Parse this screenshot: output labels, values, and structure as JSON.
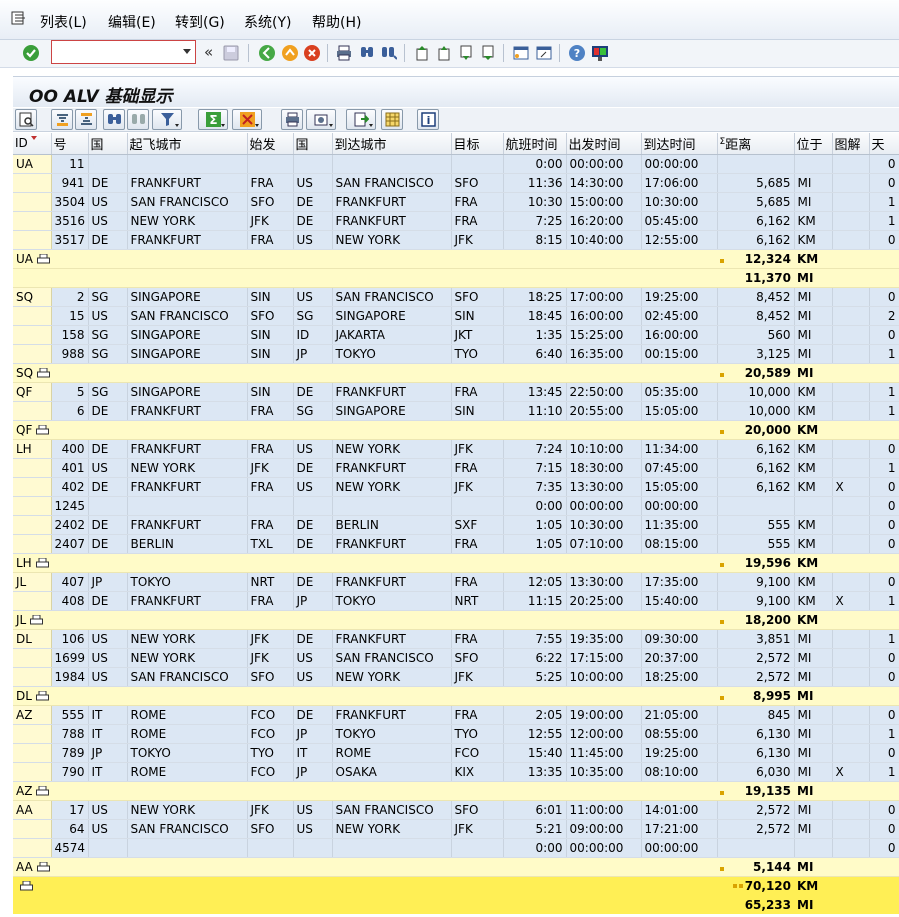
{
  "menu": [
    "列表(L)",
    "编辑(E)",
    "转到(G)",
    "系统(Y)",
    "帮助(H)"
  ],
  "toolbar": {
    "command_value": "",
    "command_placeholder": "",
    "back_symbol": "«"
  },
  "title": "OO ALV 基础显示",
  "columns": [
    "ID",
    "号",
    "国",
    "起飞城市",
    "始发",
    "国",
    "到达城市",
    "目标",
    "航班时间",
    "出发时间",
    "到达时间",
    "距离",
    "位于",
    "图解",
    "天"
  ],
  "rows": [
    {
      "id": "UA",
      "no": "11",
      "c1": "",
      "from": "",
      "fa": "",
      "c2": "",
      "to": "",
      "ta": "",
      "ft": "0:00",
      "dep": "00:00:00",
      "arr": "00:00:00",
      "dist": "",
      "unit": "",
      "ch": "",
      "day": "0"
    },
    {
      "id": "",
      "no": "941",
      "c1": "DE",
      "from": "FRANKFURT",
      "fa": "FRA",
      "c2": "US",
      "to": "SAN FRANCISCO",
      "ta": "SFO",
      "ft": "11:36",
      "dep": "14:30:00",
      "arr": "17:06:00",
      "dist": "5,685",
      "unit": "MI",
      "ch": "",
      "day": "0"
    },
    {
      "id": "",
      "no": "3504",
      "c1": "US",
      "from": "SAN FRANCISCO",
      "fa": "SFO",
      "c2": "DE",
      "to": "FRANKFURT",
      "ta": "FRA",
      "ft": "10:30",
      "dep": "15:00:00",
      "arr": "10:30:00",
      "dist": "5,685",
      "unit": "MI",
      "ch": "",
      "day": "1"
    },
    {
      "id": "",
      "no": "3516",
      "c1": "US",
      "from": "NEW YORK",
      "fa": "JFK",
      "c2": "DE",
      "to": "FRANKFURT",
      "ta": "FRA",
      "ft": "7:25",
      "dep": "16:20:00",
      "arr": "05:45:00",
      "dist": "6,162",
      "unit": "KM",
      "ch": "",
      "day": "1"
    },
    {
      "id": "",
      "no": "3517",
      "c1": "DE",
      "from": "FRANKFURT",
      "fa": "FRA",
      "c2": "US",
      "to": "NEW YORK",
      "ta": "JFK",
      "ft": "8:15",
      "dep": "10:40:00",
      "arr": "12:55:00",
      "dist": "6,162",
      "unit": "KM",
      "ch": "",
      "day": "0"
    },
    {
      "subtotal": true,
      "id": "UA",
      "lines": [
        [
          "12,324",
          "KM"
        ],
        [
          "11,370",
          "MI"
        ]
      ]
    },
    {
      "id": "SQ",
      "no": "2",
      "c1": "SG",
      "from": "SINGAPORE",
      "fa": "SIN",
      "c2": "US",
      "to": "SAN FRANCISCO",
      "ta": "SFO",
      "ft": "18:25",
      "dep": "17:00:00",
      "arr": "19:25:00",
      "dist": "8,452",
      "unit": "MI",
      "ch": "",
      "day": "0"
    },
    {
      "id": "",
      "no": "15",
      "c1": "US",
      "from": "SAN FRANCISCO",
      "fa": "SFO",
      "c2": "SG",
      "to": "SINGAPORE",
      "ta": "SIN",
      "ft": "18:45",
      "dep": "16:00:00",
      "arr": "02:45:00",
      "dist": "8,452",
      "unit": "MI",
      "ch": "",
      "day": "2"
    },
    {
      "id": "",
      "no": "158",
      "c1": "SG",
      "from": "SINGAPORE",
      "fa": "SIN",
      "c2": "ID",
      "to": "JAKARTA",
      "ta": "JKT",
      "ft": "1:35",
      "dep": "15:25:00",
      "arr": "16:00:00",
      "dist": "560",
      "unit": "MI",
      "ch": "",
      "day": "0"
    },
    {
      "id": "",
      "no": "988",
      "c1": "SG",
      "from": "SINGAPORE",
      "fa": "SIN",
      "c2": "JP",
      "to": "TOKYO",
      "ta": "TYO",
      "ft": "6:40",
      "dep": "16:35:00",
      "arr": "00:15:00",
      "dist": "3,125",
      "unit": "MI",
      "ch": "",
      "day": "1"
    },
    {
      "subtotal": true,
      "id": "SQ",
      "lines": [
        [
          "20,589",
          "MI"
        ]
      ]
    },
    {
      "id": "QF",
      "no": "5",
      "c1": "SG",
      "from": "SINGAPORE",
      "fa": "SIN",
      "c2": "DE",
      "to": "FRANKFURT",
      "ta": "FRA",
      "ft": "13:45",
      "dep": "22:50:00",
      "arr": "05:35:00",
      "dist": "10,000",
      "unit": "KM",
      "ch": "",
      "day": "1"
    },
    {
      "id": "",
      "no": "6",
      "c1": "DE",
      "from": "FRANKFURT",
      "fa": "FRA",
      "c2": "SG",
      "to": "SINGAPORE",
      "ta": "SIN",
      "ft": "11:10",
      "dep": "20:55:00",
      "arr": "15:05:00",
      "dist": "10,000",
      "unit": "KM",
      "ch": "",
      "day": "1"
    },
    {
      "subtotal": true,
      "id": "QF",
      "lines": [
        [
          "20,000",
          "KM"
        ]
      ]
    },
    {
      "id": "LH",
      "no": "400",
      "c1": "DE",
      "from": "FRANKFURT",
      "fa": "FRA",
      "c2": "US",
      "to": "NEW YORK",
      "ta": "JFK",
      "ft": "7:24",
      "dep": "10:10:00",
      "arr": "11:34:00",
      "dist": "6,162",
      "unit": "KM",
      "ch": "",
      "day": "0"
    },
    {
      "id": "",
      "no": "401",
      "c1": "US",
      "from": "NEW YORK",
      "fa": "JFK",
      "c2": "DE",
      "to": "FRANKFURT",
      "ta": "FRA",
      "ft": "7:15",
      "dep": "18:30:00",
      "arr": "07:45:00",
      "dist": "6,162",
      "unit": "KM",
      "ch": "",
      "day": "1"
    },
    {
      "id": "",
      "no": "402",
      "c1": "DE",
      "from": "FRANKFURT",
      "fa": "FRA",
      "c2": "US",
      "to": "NEW YORK",
      "ta": "JFK",
      "ft": "7:35",
      "dep": "13:30:00",
      "arr": "15:05:00",
      "dist": "6,162",
      "unit": "KM",
      "ch": "X",
      "day": "0"
    },
    {
      "id": "",
      "no": "1245",
      "c1": "",
      "from": "",
      "fa": "",
      "c2": "",
      "to": "",
      "ta": "",
      "ft": "0:00",
      "dep": "00:00:00",
      "arr": "00:00:00",
      "dist": "",
      "unit": "",
      "ch": "",
      "day": "0"
    },
    {
      "id": "",
      "no": "2402",
      "c1": "DE",
      "from": "FRANKFURT",
      "fa": "FRA",
      "c2": "DE",
      "to": "BERLIN",
      "ta": "SXF",
      "ft": "1:05",
      "dep": "10:30:00",
      "arr": "11:35:00",
      "dist": "555",
      "unit": "KM",
      "ch": "",
      "day": "0"
    },
    {
      "id": "",
      "no": "2407",
      "c1": "DE",
      "from": "BERLIN",
      "fa": "TXL",
      "c2": "DE",
      "to": "FRANKFURT",
      "ta": "FRA",
      "ft": "1:05",
      "dep": "07:10:00",
      "arr": "08:15:00",
      "dist": "555",
      "unit": "KM",
      "ch": "",
      "day": "0"
    },
    {
      "subtotal": true,
      "id": "LH",
      "lines": [
        [
          "19,596",
          "KM"
        ]
      ]
    },
    {
      "id": "JL",
      "no": "407",
      "c1": "JP",
      "from": "TOKYO",
      "fa": "NRT",
      "c2": "DE",
      "to": "FRANKFURT",
      "ta": "FRA",
      "ft": "12:05",
      "dep": "13:30:00",
      "arr": "17:35:00",
      "dist": "9,100",
      "unit": "KM",
      "ch": "",
      "day": "0"
    },
    {
      "id": "",
      "no": "408",
      "c1": "DE",
      "from": "FRANKFURT",
      "fa": "FRA",
      "c2": "JP",
      "to": "TOKYO",
      "ta": "NRT",
      "ft": "11:15",
      "dep": "20:25:00",
      "arr": "15:40:00",
      "dist": "9,100",
      "unit": "KM",
      "ch": "X",
      "day": "1"
    },
    {
      "subtotal": true,
      "id": "JL",
      "lines": [
        [
          "18,200",
          "KM"
        ]
      ]
    },
    {
      "id": "DL",
      "no": "106",
      "c1": "US",
      "from": "NEW YORK",
      "fa": "JFK",
      "c2": "DE",
      "to": "FRANKFURT",
      "ta": "FRA",
      "ft": "7:55",
      "dep": "19:35:00",
      "arr": "09:30:00",
      "dist": "3,851",
      "unit": "MI",
      "ch": "",
      "day": "1"
    },
    {
      "id": "",
      "no": "1699",
      "c1": "US",
      "from": "NEW YORK",
      "fa": "JFK",
      "c2": "US",
      "to": "SAN FRANCISCO",
      "ta": "SFO",
      "ft": "6:22",
      "dep": "17:15:00",
      "arr": "20:37:00",
      "dist": "2,572",
      "unit": "MI",
      "ch": "",
      "day": "0"
    },
    {
      "id": "",
      "no": "1984",
      "c1": "US",
      "from": "SAN FRANCISCO",
      "fa": "SFO",
      "c2": "US",
      "to": "NEW YORK",
      "ta": "JFK",
      "ft": "5:25",
      "dep": "10:00:00",
      "arr": "18:25:00",
      "dist": "2,572",
      "unit": "MI",
      "ch": "",
      "day": "0"
    },
    {
      "subtotal": true,
      "id": "DL",
      "lines": [
        [
          "8,995",
          "MI"
        ]
      ]
    },
    {
      "id": "AZ",
      "no": "555",
      "c1": "IT",
      "from": "ROME",
      "fa": "FCO",
      "c2": "DE",
      "to": "FRANKFURT",
      "ta": "FRA",
      "ft": "2:05",
      "dep": "19:00:00",
      "arr": "21:05:00",
      "dist": "845",
      "unit": "MI",
      "ch": "",
      "day": "0"
    },
    {
      "id": "",
      "no": "788",
      "c1": "IT",
      "from": "ROME",
      "fa": "FCO",
      "c2": "JP",
      "to": "TOKYO",
      "ta": "TYO",
      "ft": "12:55",
      "dep": "12:00:00",
      "arr": "08:55:00",
      "dist": "6,130",
      "unit": "MI",
      "ch": "",
      "day": "1"
    },
    {
      "id": "",
      "no": "789",
      "c1": "JP",
      "from": "TOKYO",
      "fa": "TYO",
      "c2": "IT",
      "to": "ROME",
      "ta": "FCO",
      "ft": "15:40",
      "dep": "11:45:00",
      "arr": "19:25:00",
      "dist": "6,130",
      "unit": "MI",
      "ch": "",
      "day": "0"
    },
    {
      "id": "",
      "no": "790",
      "c1": "IT",
      "from": "ROME",
      "fa": "FCO",
      "c2": "JP",
      "to": "OSAKA",
      "ta": "KIX",
      "ft": "13:35",
      "dep": "10:35:00",
      "arr": "08:10:00",
      "dist": "6,030",
      "unit": "MI",
      "ch": "X",
      "day": "1"
    },
    {
      "subtotal": true,
      "id": "AZ",
      "lines": [
        [
          "19,135",
          "MI"
        ]
      ]
    },
    {
      "id": "AA",
      "no": "17",
      "c1": "US",
      "from": "NEW YORK",
      "fa": "JFK",
      "c2": "US",
      "to": "SAN FRANCISCO",
      "ta": "SFO",
      "ft": "6:01",
      "dep": "11:00:00",
      "arr": "14:01:00",
      "dist": "2,572",
      "unit": "MI",
      "ch": "",
      "day": "0"
    },
    {
      "id": "",
      "no": "64",
      "c1": "US",
      "from": "SAN FRANCISCO",
      "fa": "SFO",
      "c2": "US",
      "to": "NEW YORK",
      "ta": "JFK",
      "ft": "5:21",
      "dep": "09:00:00",
      "arr": "17:21:00",
      "dist": "2,572",
      "unit": "MI",
      "ch": "",
      "day": "0"
    },
    {
      "id": "",
      "no": "4574",
      "c1": "",
      "from": "",
      "fa": "",
      "c2": "",
      "to": "",
      "ta": "",
      "ft": "0:00",
      "dep": "00:00:00",
      "arr": "00:00:00",
      "dist": "",
      "unit": "",
      "ch": "",
      "day": "0"
    },
    {
      "subtotal": true,
      "id": "AA",
      "lines": [
        [
          "5,144",
          "MI"
        ]
      ]
    },
    {
      "grandtotal": true,
      "id": "",
      "lines": [
        [
          "70,120",
          "KM"
        ],
        [
          "65,233",
          "MI"
        ]
      ]
    }
  ],
  "icons": {
    "menu": "list-menu-icon",
    "toolbar": [
      "enter-check-icon",
      "back-icon",
      "save-icon",
      "back-green-icon",
      "exit-icon",
      "cancel-icon",
      "print-icon",
      "find-icon",
      "find-next-icon",
      "first-page-icon",
      "prev-page-icon",
      "next-page-icon",
      "last-page-icon",
      "new-session-icon",
      "shortcut-icon",
      "help-icon",
      "customize-layout-icon"
    ],
    "alv": [
      "details-icon",
      "sort-asc-icon",
      "sort-desc-icon",
      "find-icon",
      "find-next-icon",
      "filter-icon",
      "sum-icon",
      "subtotal-icon",
      "print-preview-icon",
      "export-icon",
      "layout-icon",
      "grid-icon",
      "info-icon",
      "sum-marker-icon",
      "sort-indicator-icon"
    ]
  },
  "colors": {
    "row_blue": "#dce7f4",
    "key_yellow": "#fffad2",
    "subtotal": "#fffbc8",
    "total": "#ffef55",
    "menu_text": "#000000"
  }
}
